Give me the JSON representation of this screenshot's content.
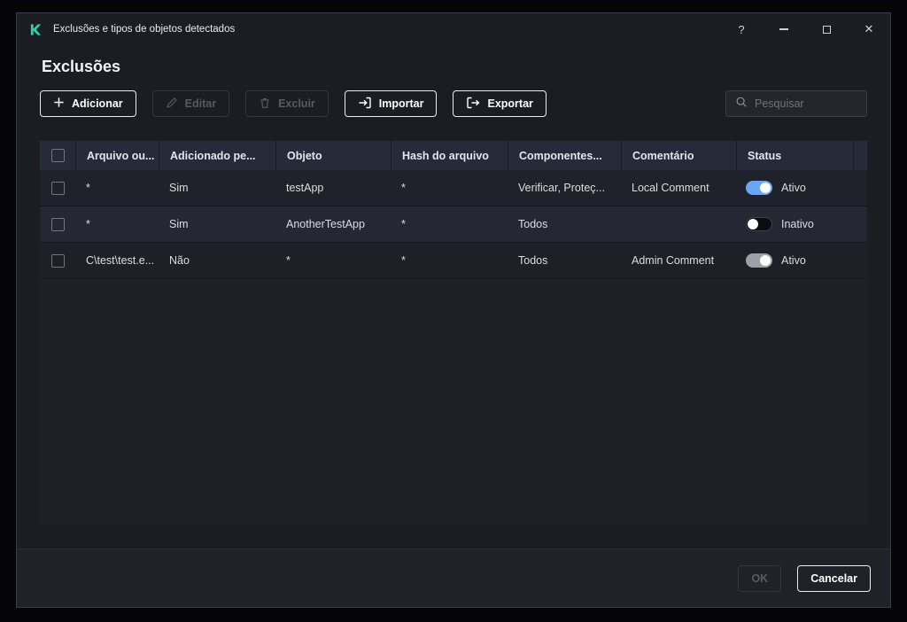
{
  "colors": {
    "accent_green": "#29d3ac",
    "toggle_on_blue": "#68a7f8",
    "toggle_on_gray": "#9da0a8",
    "window_bg": "#1c1d23",
    "table_header_bg": "#262b39"
  },
  "window": {
    "title": "Exclusões e tipos de objetos detectados",
    "controls": {
      "help": "?",
      "close": "✕"
    }
  },
  "page": {
    "title": "Exclusões"
  },
  "toolbar": {
    "add_label": "Adicionar",
    "edit_label": "Editar",
    "delete_label": "Excluir",
    "import_label": "Importar",
    "export_label": "Exportar",
    "search_placeholder": "Pesquisar"
  },
  "table": {
    "columns": {
      "file": "Arquivo ou...",
      "added_by": "Adicionado pe...",
      "object": "Objeto",
      "hash": "Hash do arquivo",
      "components": "Componentes...",
      "comment": "Comentário",
      "status": "Status"
    },
    "rows": [
      {
        "file": "*",
        "added_by": "Sim",
        "object": "testApp",
        "hash": "*",
        "components": "Verificar, Proteç...",
        "comment": "Local Comment",
        "status_label": "Ativo",
        "toggle": "on"
      },
      {
        "file": "*",
        "added_by": "Sim",
        "object": "AnotherTestApp",
        "hash": "*",
        "components": "Todos",
        "comment": "",
        "status_label": "Inativo",
        "toggle": "off"
      },
      {
        "file": "C\\test\\test.e...",
        "added_by": "Não",
        "object": "*",
        "hash": "*",
        "components": "Todos",
        "comment": "Admin Comment",
        "status_label": "Ativo",
        "toggle": "on-gray"
      }
    ]
  },
  "footer": {
    "ok_label": "OK",
    "cancel_label": "Cancelar"
  }
}
